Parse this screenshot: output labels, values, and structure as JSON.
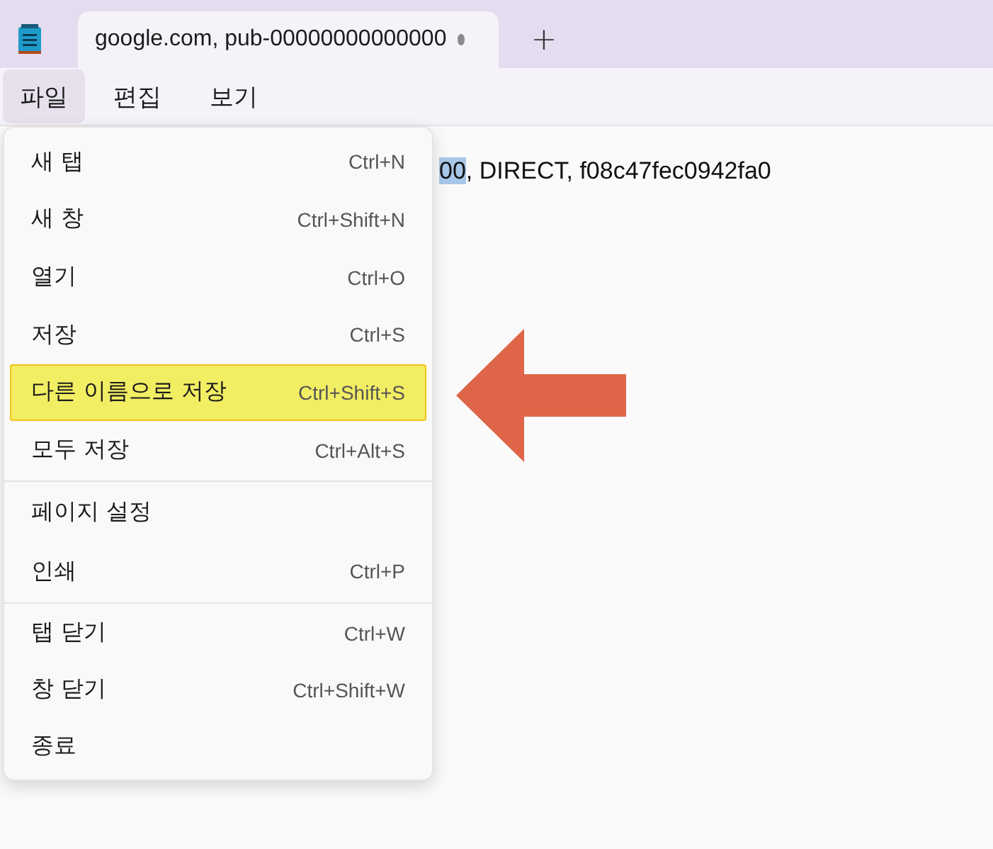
{
  "app_icon": {
    "kind": "notepad"
  },
  "tabs": [
    {
      "title": "google.com, pub-00000000000000",
      "modified": true,
      "selected": true
    }
  ],
  "new_tab": "+",
  "menubar": [
    {
      "label": "파일",
      "selected": true
    },
    {
      "label": "편집",
      "selected": false
    },
    {
      "label": "보기",
      "selected": false
    }
  ],
  "editor": {
    "selected_text": "00",
    "text": ", DIRECT, f08c47fec0942fa0"
  },
  "menu": {
    "groups": [
      [
        {
          "label": "새 탭",
          "shortcut": "Ctrl+N",
          "highlighted": false
        },
        {
          "label": "새 창",
          "shortcut": "Ctrl+Shift+N",
          "highlighted": false
        },
        {
          "label": "열기",
          "shortcut": "Ctrl+O",
          "highlighted": false
        },
        {
          "label": "저장",
          "shortcut": "Ctrl+S",
          "highlighted": false
        },
        {
          "label": "다른 이름으로 저장",
          "shortcut": "Ctrl+Shift+S",
          "highlighted": true
        },
        {
          "label": "모두 저장",
          "shortcut": "Ctrl+Alt+S",
          "highlighted": false
        }
      ],
      [
        {
          "label": "페이지 설정",
          "highlighted": false
        },
        {
          "label": "인쇄",
          "shortcut": "Ctrl+P",
          "highlighted": false
        }
      ],
      [
        {
          "label": "탭 닫기",
          "shortcut": "Ctrl+W",
          "highlighted": false
        },
        {
          "label": "창 닫기",
          "shortcut": "Ctrl+Shift+W",
          "highlighted": false
        },
        {
          "label": "종료",
          "highlighted": false
        }
      ]
    ]
  },
  "annotation": {
    "kind": "arrow",
    "color": "#df6548"
  }
}
